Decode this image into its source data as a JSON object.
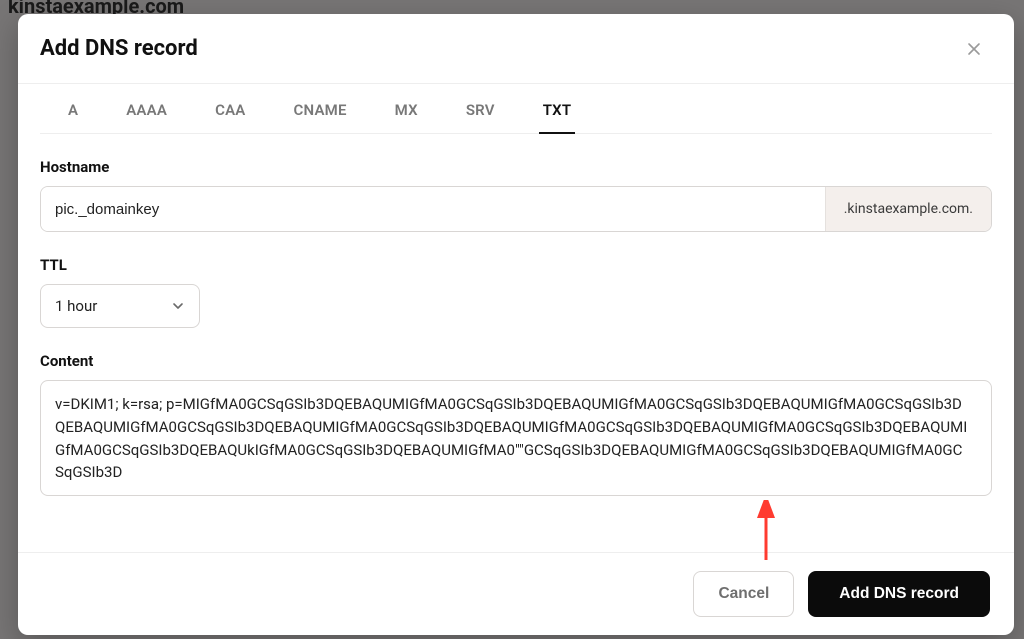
{
  "backdrop": {
    "domain_text": "kinstaexample.com"
  },
  "modal": {
    "title": "Add DNS record",
    "tabs": [
      "A",
      "AAAA",
      "CAA",
      "CNAME",
      "MX",
      "SRV",
      "TXT"
    ],
    "active_tab_index": 6,
    "fields": {
      "hostname": {
        "label": "Hostname",
        "value": "pic._domainkey",
        "suffix": ".kinstaexample.com."
      },
      "ttl": {
        "label": "TTL",
        "selected": "1 hour"
      },
      "content": {
        "label": "Content",
        "value": "v=DKIM1; k=rsa; p=MIGfMA0GCSqGSIb3DQEBAQUMIGfMA0GCSqGSIb3DQEBAQUMIGfMA0GCSqGSIb3DQEBAQUMIGfMA0GCSqGSIb3DQEBAQUMIGfMA0GCSqGSIb3DQEBAQUMIGfMA0GCSqGSIb3DQEBAQUMIGfMA0GCSqGSIb3DQEBAQUMIGfMA0GCSqGSIb3DQEBAQUMIGfMA0GCSqGSIb3DQEBAQUkIGfMA0GCSqGSIb3DQEBAQUMIGfMA0\"\"GCSqGSIb3DQEBAQUMIGfMA0GCSqGSIb3DQEBAQUMIGfMA0GCSqGSIb3D"
      }
    },
    "footer": {
      "cancel": "Cancel",
      "submit": "Add DNS record"
    }
  },
  "colors": {
    "accent_dark": "#0b0b0b",
    "annotation_arrow": "#ff3b30"
  }
}
